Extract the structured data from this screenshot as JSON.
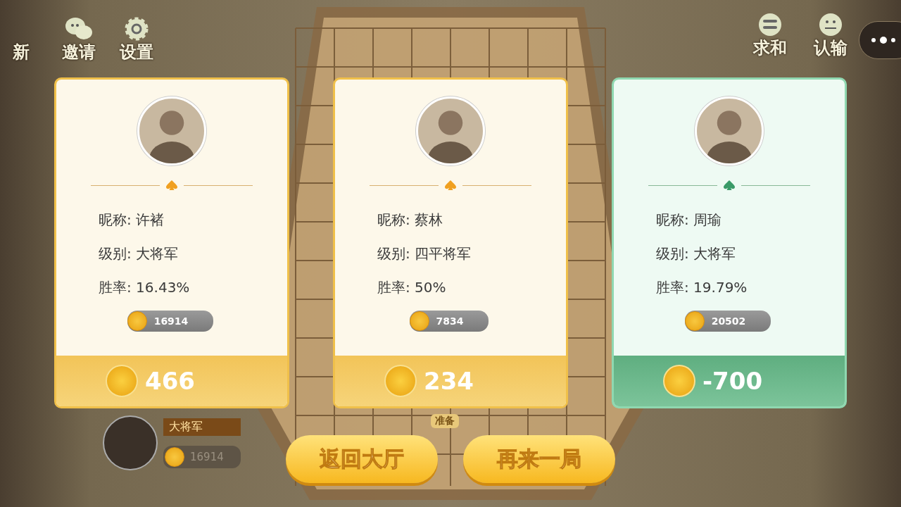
{
  "top_left_buttons": [
    {
      "label": "新"
    },
    {
      "label": "邀请"
    },
    {
      "label": "设置"
    }
  ],
  "top_right_buttons": [
    {
      "label": "求和"
    },
    {
      "label": "认输"
    }
  ],
  "background_player": {
    "rank": "大将军",
    "coins": "16914"
  },
  "ready_badge": "准备",
  "players": [
    {
      "nickname_label": "昵称: ",
      "nickname": "许褚",
      "rank_label": "级别: ",
      "rank": "大将军",
      "winrate_label": "胜率: ",
      "winrate": "16.43%",
      "coins": "16914",
      "score": "466",
      "highlighted": false
    },
    {
      "nickname_label": "昵称: ",
      "nickname": "蔡林",
      "rank_label": "级别: ",
      "rank": "四平将军",
      "winrate_label": "胜率: ",
      "winrate": "50%",
      "coins": "7834",
      "score": "234",
      "highlighted": false
    },
    {
      "nickname_label": "昵称: ",
      "nickname": "周瑜",
      "rank_label": "级别: ",
      "rank": "大将军",
      "winrate_label": "胜率: ",
      "winrate": "19.79%",
      "coins": "20502",
      "score": "-700",
      "highlighted": true
    }
  ],
  "actions": [
    {
      "label": "返回大厅"
    },
    {
      "label": "再来一局"
    }
  ]
}
